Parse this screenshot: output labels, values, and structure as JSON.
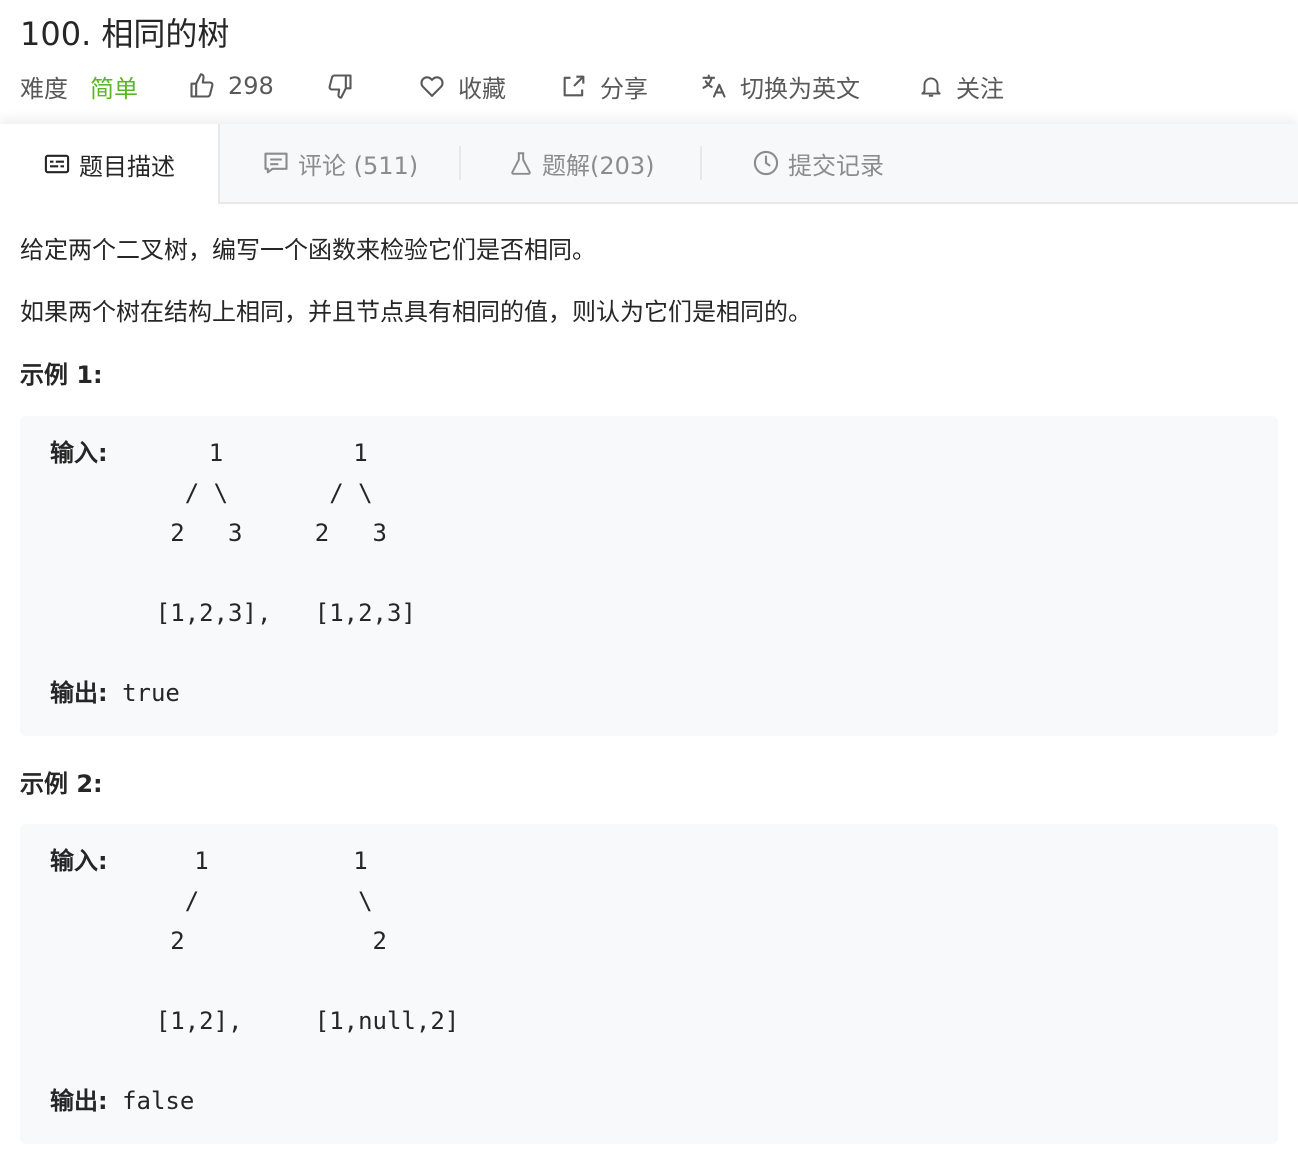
{
  "problem": {
    "title": "100. 相同的树"
  },
  "meta": {
    "difficulty_label": "难度",
    "difficulty_value": "简单",
    "likes": "298",
    "favorite_label": "收藏",
    "share_label": "分享",
    "switch_lang_label": "切换为英文",
    "follow_label": "关注",
    "colors": {
      "difficulty": "#5ab726"
    }
  },
  "tabs": [
    {
      "label": "题目描述",
      "icon": "description-icon",
      "active": true
    },
    {
      "label": "评论 (511)",
      "icon": "comment-icon",
      "active": false
    },
    {
      "label": "题解(203)",
      "icon": "flask-icon",
      "active": false
    },
    {
      "label": "提交记录",
      "icon": "clock-icon",
      "active": false
    }
  ],
  "description": {
    "p1": "给定两个二叉树，编写一个函数来检验它们是否相同。",
    "p2": "如果两个树在结构上相同，并且节点具有相同的值，则认为它们是相同的。"
  },
  "examples": [
    {
      "heading": "示例 1:",
      "input_label": "输入:",
      "lines": [
        "       1         1",
        "      / \\       / \\",
        "     2   3     2   3",
        "",
        "    [1,2,3],   [1,2,3]"
      ],
      "output_label": "输出:",
      "output_value": "true"
    },
    {
      "heading": "示例 2:",
      "input_label": "输入:",
      "lines": [
        "      1          1",
        "      /           \\",
        "     2             2",
        "",
        "    [1,2],     [1,null,2]"
      ],
      "output_label": "输出:",
      "output_value": "false"
    }
  ]
}
